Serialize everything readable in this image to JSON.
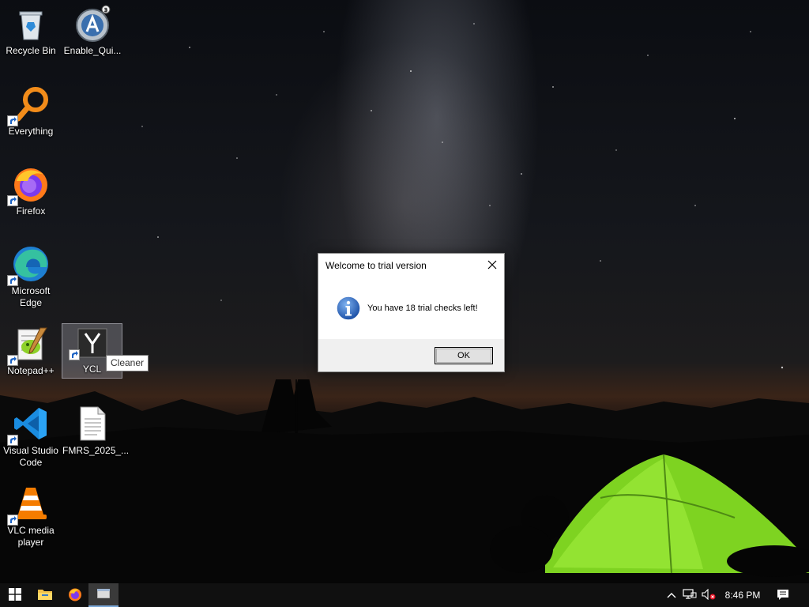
{
  "desktop": {
    "icons": [
      {
        "label": "Recycle Bin",
        "icon": "recycle-bin-icon"
      },
      {
        "label": "Enable_Qui...",
        "icon": "autoit-icon"
      },
      {
        "label": "Everything",
        "icon": "everything-search-icon"
      },
      {
        "label": "Firefox",
        "icon": "firefox-icon"
      },
      {
        "label": "Microsoft Edge",
        "icon": "edge-icon"
      },
      {
        "label": "Notepad++",
        "icon": "notepadpp-icon"
      },
      {
        "label": "YCL",
        "icon": "ycl-icon",
        "selected": true
      },
      {
        "label": "Visual Studio Code",
        "icon": "vscode-icon"
      },
      {
        "label": "FMRS_2025_...",
        "icon": "document-icon"
      },
      {
        "label": "VLC media player",
        "icon": "vlc-icon"
      }
    ],
    "tooltip": "Cleaner"
  },
  "dialog": {
    "title": "Welcome to trial version",
    "message": "You have 18 trial checks left!",
    "ok_label": "OK",
    "icon": "info-icon"
  },
  "taskbar": {
    "items": [
      "start-icon",
      "file-explorer-icon",
      "firefox-icon",
      "active-app-icon"
    ],
    "tray": [
      "chevron-up-icon",
      "network-icon",
      "volume-muted-icon"
    ],
    "clock": "8:46 PM",
    "notifications_icon": "action-center-icon"
  },
  "colors": {
    "taskbar": "#101010",
    "dialog_footer": "#f0f0f0",
    "tent_green": "#7ed321",
    "sunset_orange": "#d6601e"
  }
}
